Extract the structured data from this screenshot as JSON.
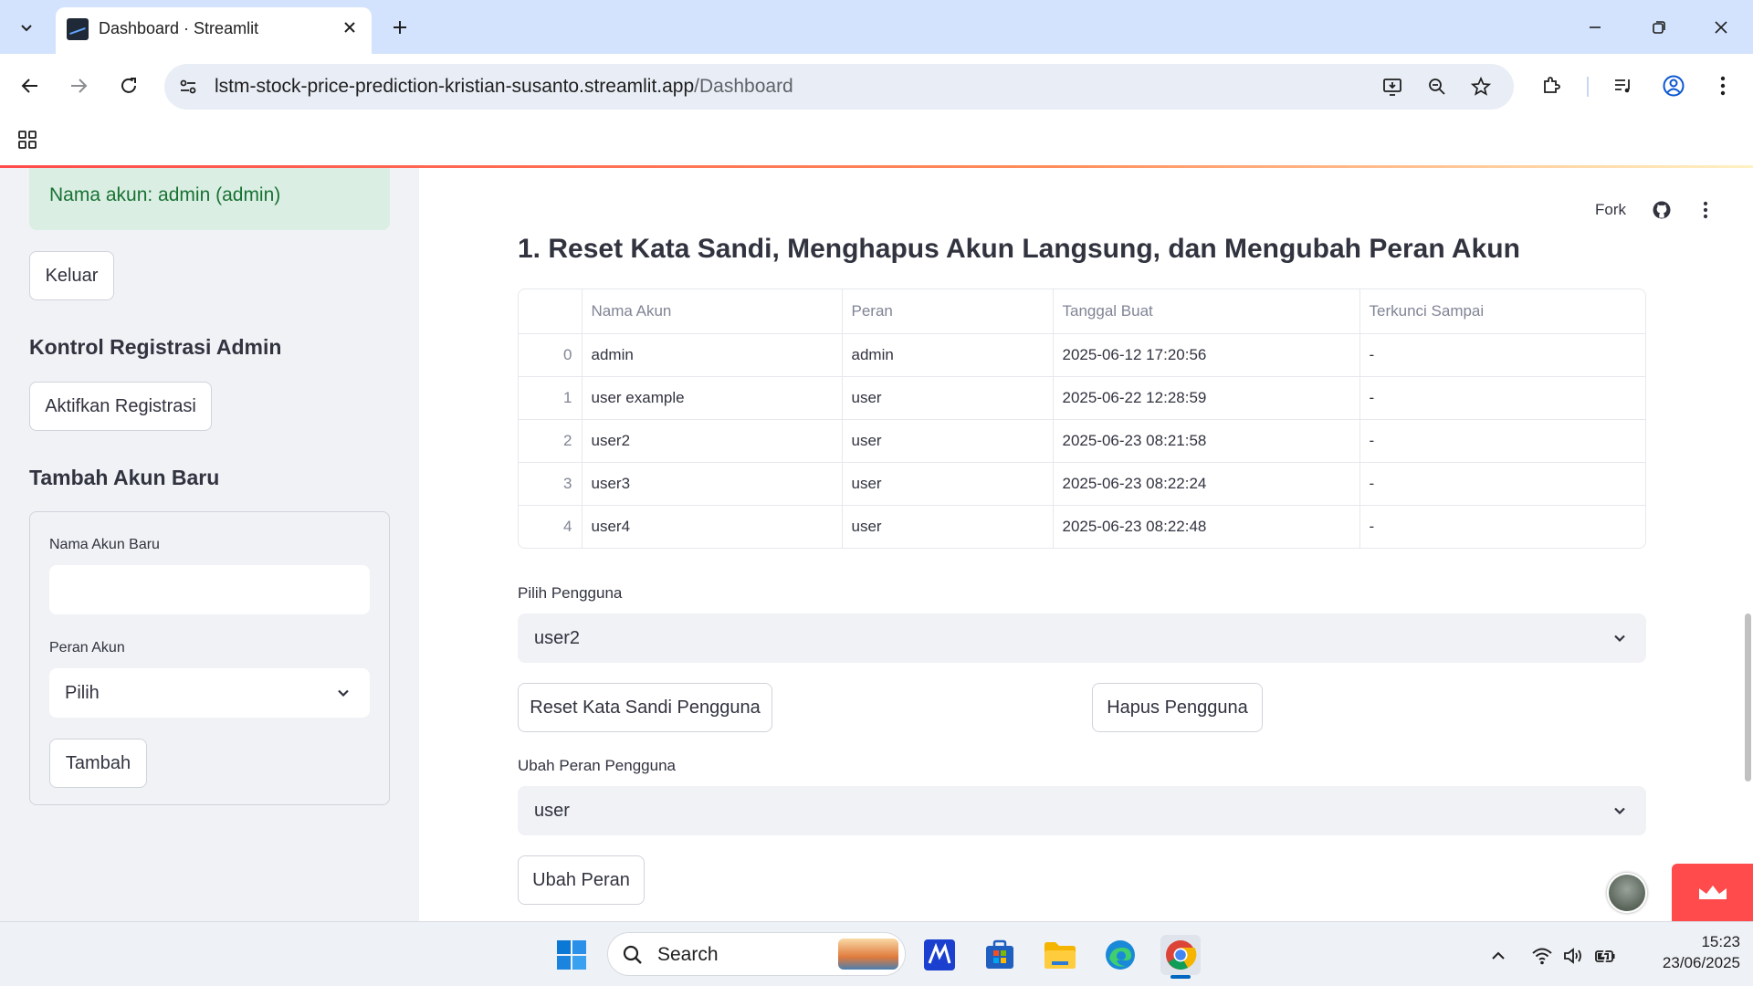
{
  "browser": {
    "tab_title": "Dashboard · Streamlit",
    "url_host": "lstm-stock-price-prediction-kristian-susanto.streamlit.app",
    "url_path": "/Dashboard"
  },
  "sidebar": {
    "account_info": "Nama akun: admin (admin)",
    "logout_label": "Keluar",
    "registration_heading": "Kontrol Registrasi Admin",
    "enable_registration_label": "Aktifkan Registrasi",
    "add_account_heading": "Tambah Akun Baru",
    "new_account_name_label": "Nama Akun Baru",
    "new_account_name_value": "",
    "role_label": "Peran Akun",
    "role_selected": "Pilih",
    "add_button_label": "Tambah"
  },
  "main": {
    "fork_label": "Fork",
    "section_title": "1. Reset Kata Sandi, Menghapus Akun Langsung, dan Mengubah Peran Akun",
    "table": {
      "headers": [
        "",
        "Nama Akun",
        "Peran",
        "Tanggal Buat",
        "Terkunci Sampai"
      ],
      "rows": [
        [
          "0",
          "admin",
          "admin",
          "2025-06-12 17:20:56",
          "-"
        ],
        [
          "1",
          "user example",
          "user",
          "2025-06-22 12:28:59",
          "-"
        ],
        [
          "2",
          "user2",
          "user",
          "2025-06-23 08:21:58",
          "-"
        ],
        [
          "3",
          "user3",
          "user",
          "2025-06-23 08:22:24",
          "-"
        ],
        [
          "4",
          "user4",
          "user",
          "2025-06-23 08:22:48",
          "-"
        ]
      ]
    },
    "select_user_label": "Pilih Pengguna",
    "select_user_value": "user2",
    "reset_password_label": "Reset Kata Sandi Pengguna",
    "delete_user_label": "Hapus Pengguna",
    "change_role_label": "Ubah Peran Pengguna",
    "change_role_value": "user",
    "change_role_button_label": "Ubah Peran"
  },
  "taskbar": {
    "search_placeholder": "Search",
    "time": "15:23",
    "date": "23/06/2025"
  },
  "colors": {
    "tabbar_bg": "#d3e3fd",
    "sidebar_bg": "#f0f2f6",
    "success_bg": "#dbeee3",
    "success_text": "#177233",
    "streamlit_red": "#ff4b4b"
  }
}
